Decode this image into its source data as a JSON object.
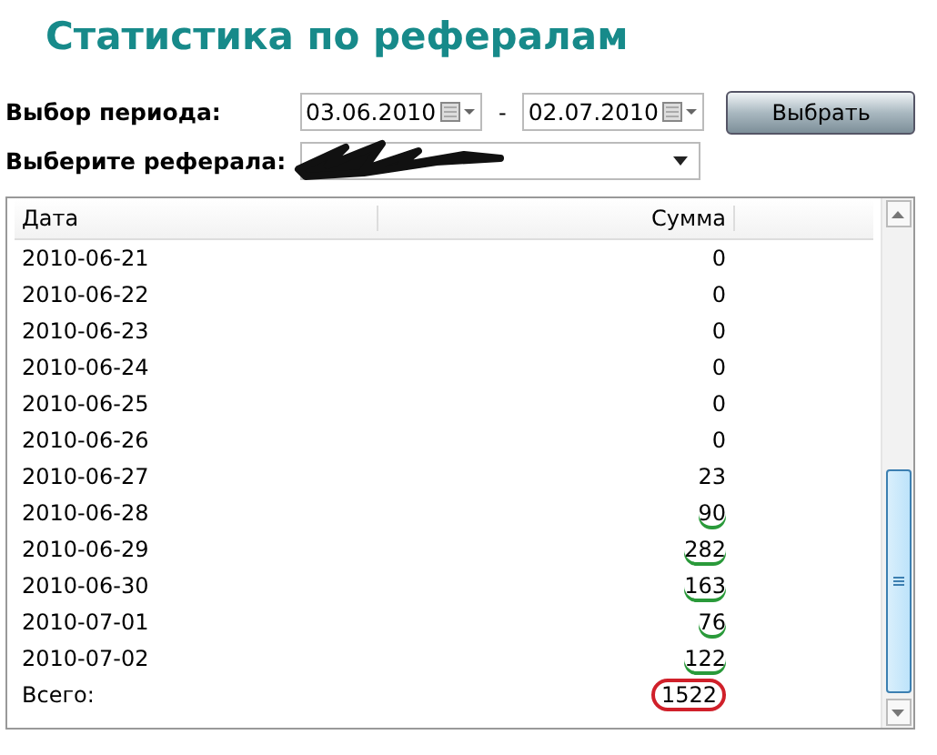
{
  "title": "Статистика по рефералам",
  "period": {
    "label": "Выбор периода:",
    "from": "03.06.2010",
    "separator": "-",
    "to": "02.07.2010",
    "button": "Выбрать"
  },
  "referral": {
    "label": "Выберите реферала:",
    "scribbled": true
  },
  "table": {
    "columns": [
      "Дата",
      "Сумма"
    ],
    "rows": [
      {
        "date": "2010-06-21",
        "sum": "0",
        "underlined": false
      },
      {
        "date": "2010-06-22",
        "sum": "0",
        "underlined": false
      },
      {
        "date": "2010-06-23",
        "sum": "0",
        "underlined": false
      },
      {
        "date": "2010-06-24",
        "sum": "0",
        "underlined": false
      },
      {
        "date": "2010-06-25",
        "sum": "0",
        "underlined": false
      },
      {
        "date": "2010-06-26",
        "sum": "0",
        "underlined": false
      },
      {
        "date": "2010-06-27",
        "sum": "23",
        "underlined": false
      },
      {
        "date": "2010-06-28",
        "sum": "90",
        "underlined": true
      },
      {
        "date": "2010-06-29",
        "sum": "282",
        "underlined": true
      },
      {
        "date": "2010-06-30",
        "sum": "163",
        "underlined": true
      },
      {
        "date": "2010-07-01",
        "sum": "76",
        "underlined": true
      },
      {
        "date": "2010-07-02",
        "sum": "122",
        "underlined": true
      }
    ],
    "total": {
      "label": "Всего:",
      "sum": "1522",
      "circled": true
    }
  }
}
